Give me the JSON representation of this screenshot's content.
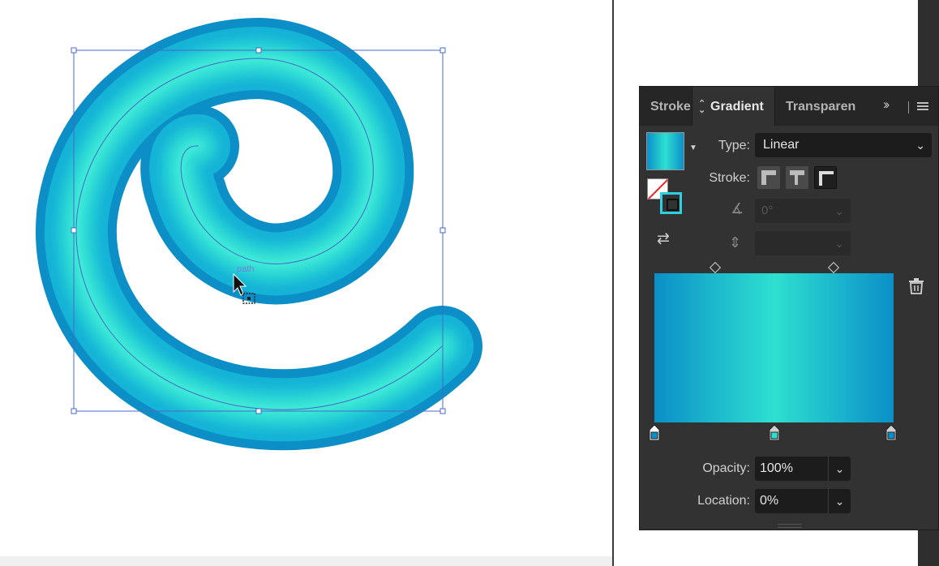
{
  "canvas": {
    "object_label": "path",
    "colors": {
      "gradient_dark": "#0b8fc8",
      "gradient_light": "#2de0d0",
      "selection": "#4a68c8"
    }
  },
  "panel": {
    "tabs": [
      {
        "label": "Stroke",
        "active": false
      },
      {
        "label": "Gradient",
        "active": true
      },
      {
        "label": "Transparen",
        "active": false
      }
    ],
    "type_label": "Type:",
    "type_value": "Linear",
    "stroke_label": "Stroke:",
    "angle_value": "0°",
    "opacity_label": "Opacity:",
    "opacity_value": "100%",
    "location_label": "Location:",
    "location_value": "0%",
    "gradient_stops": [
      {
        "color": "#0b8fc8",
        "location": 0
      },
      {
        "color": "#2de0d0",
        "location": 50
      },
      {
        "color": "#0b8fc8",
        "location": 100
      }
    ],
    "midpoints": [
      25,
      75
    ],
    "icons": [
      "updown-arrows-icon",
      "expand-panel-icon",
      "panel-menu-icon",
      "gradient-swatch",
      "fill-stroke-icon",
      "reverse-gradient-icon",
      "angle-icon",
      "aspect-ratio-icon",
      "trash-icon"
    ]
  }
}
